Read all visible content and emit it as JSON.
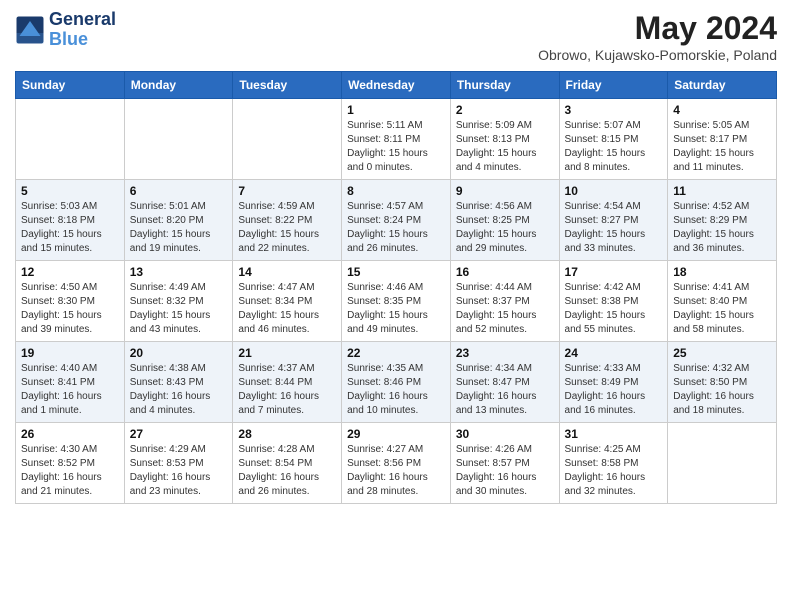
{
  "header": {
    "logo_line1": "General",
    "logo_line2": "Blue",
    "month_title": "May 2024",
    "location": "Obrowo, Kujawsko-Pomorskie, Poland"
  },
  "days_of_week": [
    "Sunday",
    "Monday",
    "Tuesday",
    "Wednesday",
    "Thursday",
    "Friday",
    "Saturday"
  ],
  "weeks": [
    [
      {
        "day": "",
        "info": ""
      },
      {
        "day": "",
        "info": ""
      },
      {
        "day": "",
        "info": ""
      },
      {
        "day": "1",
        "info": "Sunrise: 5:11 AM\nSunset: 8:11 PM\nDaylight: 15 hours\nand 0 minutes."
      },
      {
        "day": "2",
        "info": "Sunrise: 5:09 AM\nSunset: 8:13 PM\nDaylight: 15 hours\nand 4 minutes."
      },
      {
        "day": "3",
        "info": "Sunrise: 5:07 AM\nSunset: 8:15 PM\nDaylight: 15 hours\nand 8 minutes."
      },
      {
        "day": "4",
        "info": "Sunrise: 5:05 AM\nSunset: 8:17 PM\nDaylight: 15 hours\nand 11 minutes."
      }
    ],
    [
      {
        "day": "5",
        "info": "Sunrise: 5:03 AM\nSunset: 8:18 PM\nDaylight: 15 hours\nand 15 minutes."
      },
      {
        "day": "6",
        "info": "Sunrise: 5:01 AM\nSunset: 8:20 PM\nDaylight: 15 hours\nand 19 minutes."
      },
      {
        "day": "7",
        "info": "Sunrise: 4:59 AM\nSunset: 8:22 PM\nDaylight: 15 hours\nand 22 minutes."
      },
      {
        "day": "8",
        "info": "Sunrise: 4:57 AM\nSunset: 8:24 PM\nDaylight: 15 hours\nand 26 minutes."
      },
      {
        "day": "9",
        "info": "Sunrise: 4:56 AM\nSunset: 8:25 PM\nDaylight: 15 hours\nand 29 minutes."
      },
      {
        "day": "10",
        "info": "Sunrise: 4:54 AM\nSunset: 8:27 PM\nDaylight: 15 hours\nand 33 minutes."
      },
      {
        "day": "11",
        "info": "Sunrise: 4:52 AM\nSunset: 8:29 PM\nDaylight: 15 hours\nand 36 minutes."
      }
    ],
    [
      {
        "day": "12",
        "info": "Sunrise: 4:50 AM\nSunset: 8:30 PM\nDaylight: 15 hours\nand 39 minutes."
      },
      {
        "day": "13",
        "info": "Sunrise: 4:49 AM\nSunset: 8:32 PM\nDaylight: 15 hours\nand 43 minutes."
      },
      {
        "day": "14",
        "info": "Sunrise: 4:47 AM\nSunset: 8:34 PM\nDaylight: 15 hours\nand 46 minutes."
      },
      {
        "day": "15",
        "info": "Sunrise: 4:46 AM\nSunset: 8:35 PM\nDaylight: 15 hours\nand 49 minutes."
      },
      {
        "day": "16",
        "info": "Sunrise: 4:44 AM\nSunset: 8:37 PM\nDaylight: 15 hours\nand 52 minutes."
      },
      {
        "day": "17",
        "info": "Sunrise: 4:42 AM\nSunset: 8:38 PM\nDaylight: 15 hours\nand 55 minutes."
      },
      {
        "day": "18",
        "info": "Sunrise: 4:41 AM\nSunset: 8:40 PM\nDaylight: 15 hours\nand 58 minutes."
      }
    ],
    [
      {
        "day": "19",
        "info": "Sunrise: 4:40 AM\nSunset: 8:41 PM\nDaylight: 16 hours\nand 1 minute."
      },
      {
        "day": "20",
        "info": "Sunrise: 4:38 AM\nSunset: 8:43 PM\nDaylight: 16 hours\nand 4 minutes."
      },
      {
        "day": "21",
        "info": "Sunrise: 4:37 AM\nSunset: 8:44 PM\nDaylight: 16 hours\nand 7 minutes."
      },
      {
        "day": "22",
        "info": "Sunrise: 4:35 AM\nSunset: 8:46 PM\nDaylight: 16 hours\nand 10 minutes."
      },
      {
        "day": "23",
        "info": "Sunrise: 4:34 AM\nSunset: 8:47 PM\nDaylight: 16 hours\nand 13 minutes."
      },
      {
        "day": "24",
        "info": "Sunrise: 4:33 AM\nSunset: 8:49 PM\nDaylight: 16 hours\nand 16 minutes."
      },
      {
        "day": "25",
        "info": "Sunrise: 4:32 AM\nSunset: 8:50 PM\nDaylight: 16 hours\nand 18 minutes."
      }
    ],
    [
      {
        "day": "26",
        "info": "Sunrise: 4:30 AM\nSunset: 8:52 PM\nDaylight: 16 hours\nand 21 minutes."
      },
      {
        "day": "27",
        "info": "Sunrise: 4:29 AM\nSunset: 8:53 PM\nDaylight: 16 hours\nand 23 minutes."
      },
      {
        "day": "28",
        "info": "Sunrise: 4:28 AM\nSunset: 8:54 PM\nDaylight: 16 hours\nand 26 minutes."
      },
      {
        "day": "29",
        "info": "Sunrise: 4:27 AM\nSunset: 8:56 PM\nDaylight: 16 hours\nand 28 minutes."
      },
      {
        "day": "30",
        "info": "Sunrise: 4:26 AM\nSunset: 8:57 PM\nDaylight: 16 hours\nand 30 minutes."
      },
      {
        "day": "31",
        "info": "Sunrise: 4:25 AM\nSunset: 8:58 PM\nDaylight: 16 hours\nand 32 minutes."
      },
      {
        "day": "",
        "info": ""
      }
    ]
  ]
}
